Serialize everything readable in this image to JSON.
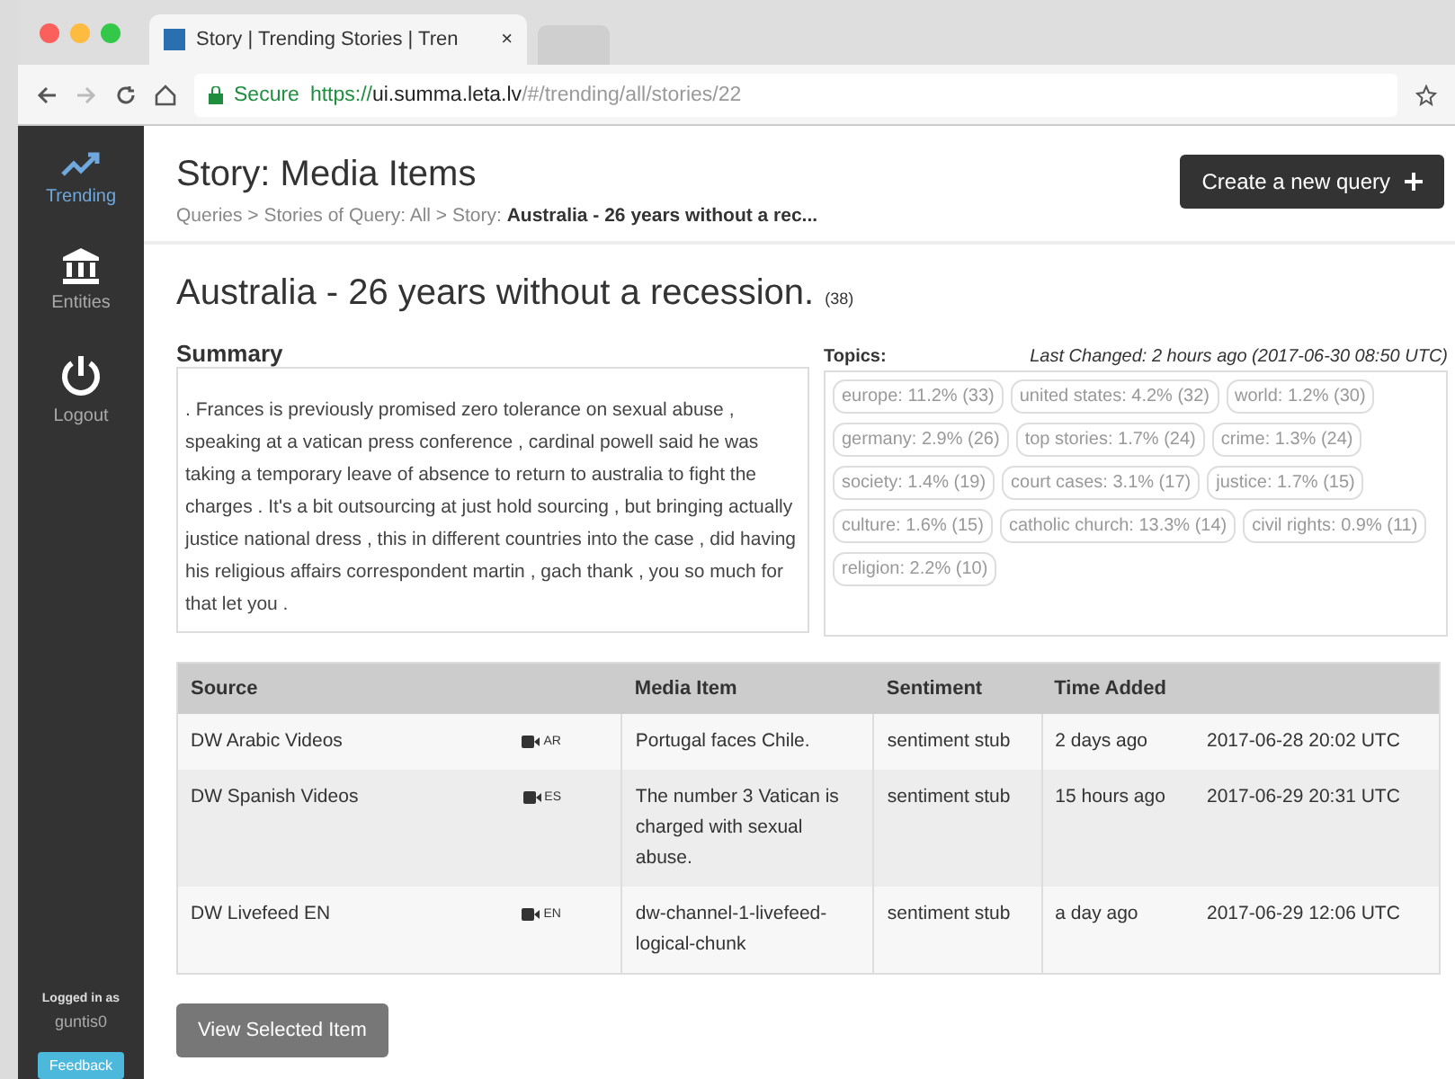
{
  "browser": {
    "tab_title": "Story | Trending Stories | Tren",
    "tab_close": "×",
    "secure_label": "Secure",
    "url_scheme": "https://",
    "url_host": "ui.summa.leta.lv",
    "url_path": "/#/trending/all/stories/22"
  },
  "sidebar": {
    "items": [
      {
        "kind": "trend",
        "label": "Trending",
        "selected": true
      },
      {
        "kind": "bank",
        "label": "Entities",
        "selected": false
      },
      {
        "kind": "power",
        "label": "Logout",
        "selected": false
      }
    ],
    "logged_in_label": "Logged in as",
    "user": "guntis0",
    "feedback": "Feedback"
  },
  "header": {
    "title": "Story: Media Items",
    "breadcrumb": "Queries > Stories of Query: All > Story: **Australia - 26 years without a rec...**",
    "new_query_button": "Create a new query"
  },
  "story": {
    "title": "Australia - 26 years without a recession.",
    "count": "(38)",
    "summary_heading": "Summary",
    "summary": ". Frances is previously promised zero tolerance on sexual abuse , speaking at a vatican press conference , cardinal powell said he was taking a temporary leave of absence to return to australia to fight the charges . It's a bit outsourcing at just hold sourcing , but bringing actually justice national dress , this in different countries into the case , did having his religious affairs correspondent martin , gach thank , you so much for that let you .",
    "topics_label": "Topics:",
    "last_changed": "Last Changed: 2 hours ago (2017-06-30 08:50 UTC)",
    "topics": [
      "europe: 11.2% (33)",
      "united states: 4.2% (32)",
      "world: 1.2% (30)",
      "germany: 2.9% (26)",
      "top stories: 1.7% (24)",
      "crime: 1.3% (24)",
      "society: 1.4% (19)",
      "court cases: 3.1% (17)",
      "justice: 1.7% (15)",
      "culture: 1.6% (15)",
      "catholic church: 13.3% (14)",
      "civil rights: 0.9% (11)",
      "religion: 2.2% (10)"
    ]
  },
  "table": {
    "columns": [
      "Source",
      "Media Item",
      "Sentiment",
      "Time Added"
    ],
    "rows": [
      {
        "source": "DW Arabic Videos",
        "lang": "AR",
        "item": "Portugal faces Chile.",
        "sentiment": "sentiment stub",
        "ago": "2 days ago",
        "time": "2017-06-28 20:02 UTC"
      },
      {
        "source": "DW Spanish Videos",
        "lang": "ES",
        "item": "The number 3 Vatican is charged with sexual abuse.",
        "sentiment": "sentiment stub",
        "ago": "15 hours ago",
        "time": "2017-06-29 20:31 UTC"
      },
      {
        "source": "DW Livefeed EN",
        "lang": "EN",
        "item": "dw-channel-1-livefeed-logical-chunk",
        "sentiment": "sentiment stub",
        "ago": "a day ago",
        "time": "2017-06-29 12:06 UTC"
      }
    ]
  },
  "view_button": "View Selected Item"
}
